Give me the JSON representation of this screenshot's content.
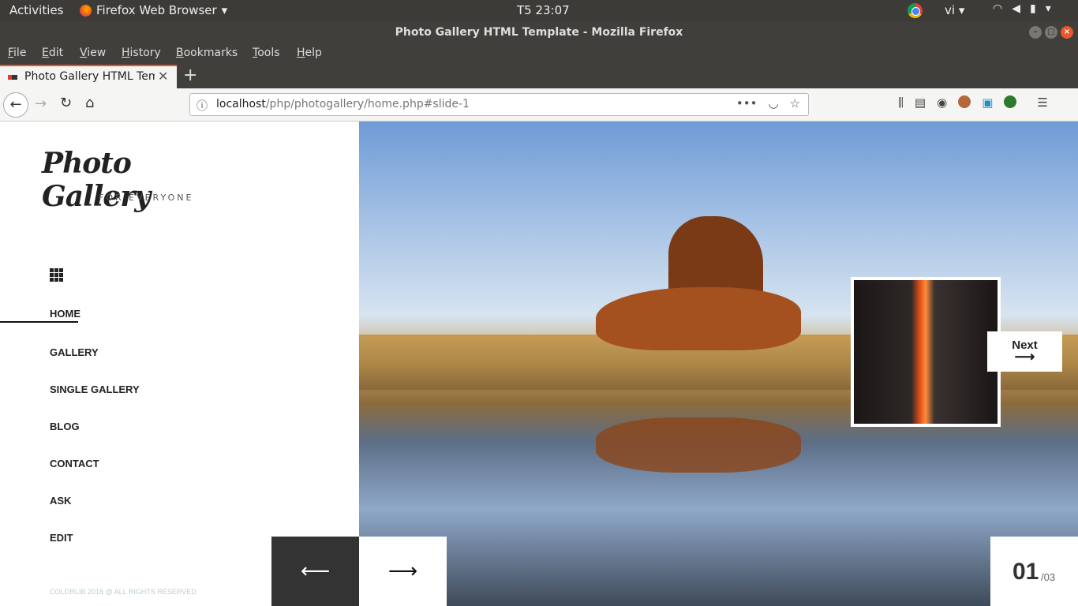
{
  "system_bar": {
    "activities": "Activities",
    "app_name": "Firefox Web Browser",
    "clock": "T5 23:07",
    "language": "vi"
  },
  "window": {
    "title": "Photo Gallery HTML Template - Mozilla Firefox"
  },
  "menu_bar": [
    "File",
    "Edit",
    "View",
    "History",
    "Bookmarks",
    "Tools",
    "Help"
  ],
  "tab": {
    "title": "Photo Gallery HTML Tem"
  },
  "url": {
    "host": "localhost",
    "path": "/php/photogallery/home.php#slide-1"
  },
  "site": {
    "logo": "Photo Gallery",
    "tagline": "FOR EVERYONE",
    "nav": [
      "HOME",
      "GALLERY",
      "SINGLE GALLERY",
      "BLOG",
      "CONTACT",
      "ASK",
      "EDIT"
    ],
    "active_nav": "HOME",
    "footer": "COLORLIB 2018 @ ALL RIGHTS RESERVED"
  },
  "slider": {
    "next_label": "Next",
    "current": "01",
    "total": "/03"
  },
  "colors": {
    "accent": "#e8582a",
    "dark_button": "#333333"
  }
}
